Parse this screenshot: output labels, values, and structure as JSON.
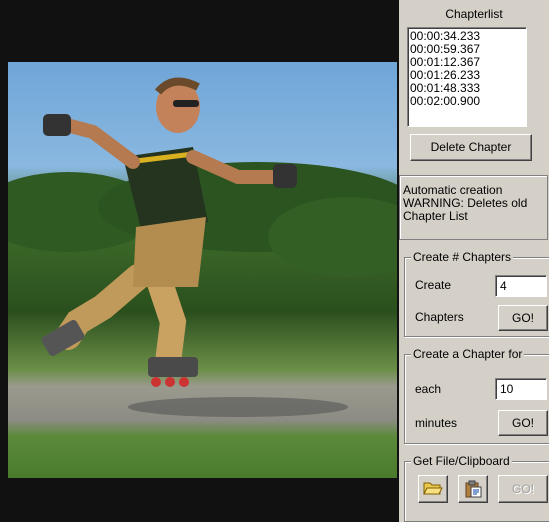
{
  "chapter_list": {
    "title": "Chapterlist",
    "items": [
      "00:00:34.233",
      "00:00:59.367",
      "00:01:12.367",
      "00:01:26.233",
      "00:01:48.333",
      "00:02:00.900"
    ]
  },
  "delete_button": "Delete Chapter",
  "automatic": {
    "line1": "Automatic  creation",
    "line2": "WARNING: Deletes old",
    "line3": "Chapter List"
  },
  "create_chapters": {
    "legend": "Create # Chapters",
    "label_create": "Create",
    "label_chapters": "Chapters",
    "value": "4",
    "go": "GO!"
  },
  "create_for": {
    "legend": "Create a Chapter for",
    "label_each": "each",
    "label_minutes": "minutes",
    "value": "10",
    "go": "GO!"
  },
  "file_clipboard": {
    "legend": "Get File/Clipboard",
    "open_icon": "folder-open-icon",
    "paste_icon": "clipboard-paste-icon",
    "go": "GO!"
  }
}
